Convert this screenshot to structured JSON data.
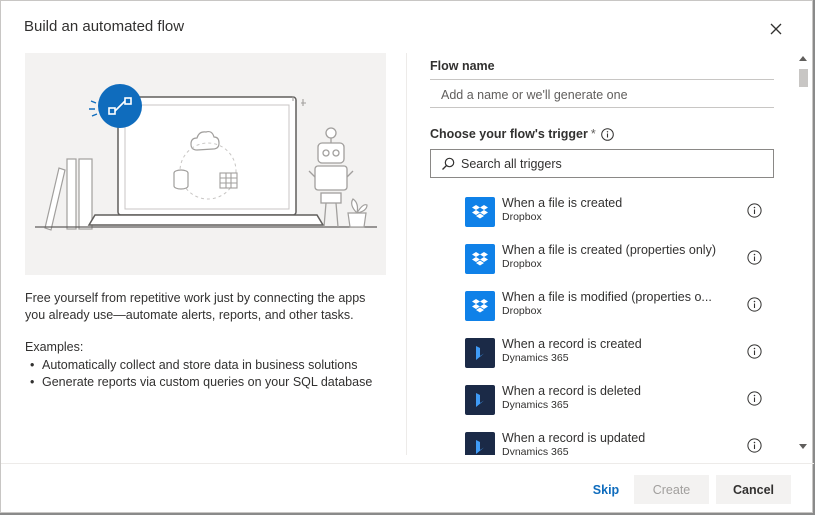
{
  "dialog": {
    "title": "Build an automated flow",
    "close_icon": "close-icon"
  },
  "left": {
    "description": "Free yourself from repetitive work just by connecting the apps you already use—automate alerts, reports, and other tasks.",
    "examples_label": "Examples:",
    "examples": [
      "Automatically collect and store data in business solutions",
      "Generate reports via custom queries on your SQL database"
    ]
  },
  "form": {
    "flow_name_label": "Flow name",
    "flow_name_placeholder": "Add a name or we'll generate one",
    "trigger_label": "Choose your flow's trigger",
    "required_mark": "*",
    "search_placeholder": "Search all triggers"
  },
  "triggers": [
    {
      "name": "When a file is created",
      "app": "Dropbox",
      "icon": "dropbox-icon"
    },
    {
      "name": "When a file is created (properties only)",
      "app": "Dropbox",
      "icon": "dropbox-icon"
    },
    {
      "name": "When a file is modified (properties o...",
      "app": "Dropbox",
      "icon": "dropbox-icon"
    },
    {
      "name": "When a record is created",
      "app": "Dynamics 365",
      "icon": "dynamics-365-icon"
    },
    {
      "name": "When a record is deleted",
      "app": "Dynamics 365",
      "icon": "dynamics-365-icon"
    },
    {
      "name": "When a record is updated",
      "app": "Dynamics 365",
      "icon": "dynamics-365-icon"
    }
  ],
  "footer": {
    "skip_label": "Skip",
    "create_label": "Create",
    "cancel_label": "Cancel"
  },
  "colors": {
    "accent": "#0f6cbd",
    "dropbox": "#0f81e8",
    "dynamics": "#1b2a47",
    "illustration_blue": "#0078d4"
  }
}
